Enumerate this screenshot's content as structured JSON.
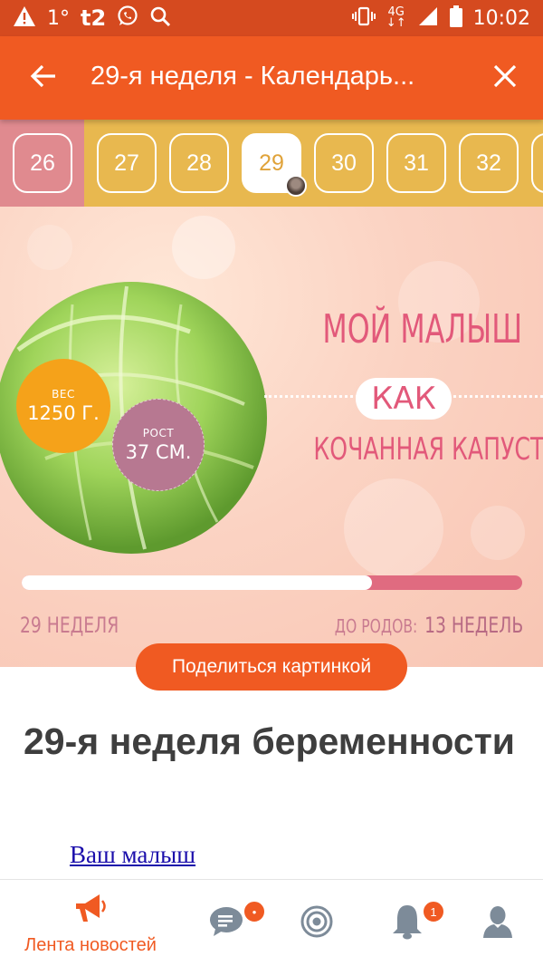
{
  "status_bar": {
    "temperature": "1°",
    "carrier": "t2",
    "network": "4G",
    "time": "10:02",
    "icons": [
      "warning-icon",
      "whatsapp-icon",
      "search-icon",
      "vibrate-icon",
      "signal-icon",
      "battery-icon"
    ]
  },
  "app_bar": {
    "title": "29-я неделя - Календарь...",
    "back_icon": "arrow-left-icon",
    "close_icon": "close-icon"
  },
  "weeks": {
    "items": [
      "26",
      "27",
      "28",
      "29",
      "30",
      "31",
      "32"
    ],
    "current": "29"
  },
  "banner": {
    "headline_line1": "МОЙ МАЛЫШ",
    "headline_like": "КАК",
    "headline_line2": "КОЧАННАЯ КАПУСТА",
    "weight_label": "ВЕС",
    "weight_value": "1250 Г.",
    "height_label": "РОСТ",
    "height_value": "37 СМ.",
    "week_label": "29 НЕДЕЛЯ",
    "remaining_label": "ДО РОДОВ:",
    "remaining_value": "13 НЕДЕЛЬ",
    "progress_fraction": 0.7
  },
  "share_button": "Поделиться картинкой",
  "article": {
    "title": "29-я неделя беременности",
    "link": "Ваш малыш"
  },
  "bottom_nav": {
    "items": [
      {
        "label": "Лента новостей",
        "icon": "megaphone-icon"
      },
      {
        "label": "",
        "icon": "chat-icon",
        "badge": "•"
      },
      {
        "label": "",
        "icon": "target-icon"
      },
      {
        "label": "",
        "icon": "bell-icon",
        "badge": "1"
      },
      {
        "label": "",
        "icon": "profile-icon"
      }
    ]
  },
  "colors": {
    "primary": "#f05a22",
    "status_bar": "#d54a1f",
    "week_strip": "#e8b84f",
    "past_week": "#e08a8f",
    "banner_text": "#e2597a"
  }
}
